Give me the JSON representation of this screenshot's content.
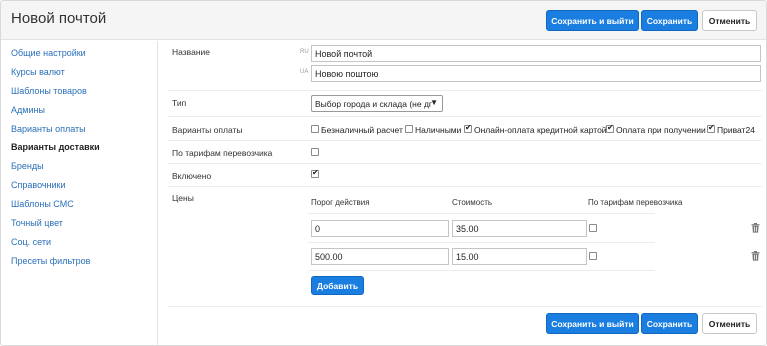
{
  "header": {
    "title": "Новой почтой",
    "save_exit_label": "Сохранить и выйти",
    "save_label": "Сохранить",
    "cancel_label": "Отменить"
  },
  "sidebar": {
    "items": [
      {
        "label": "Общие настройки"
      },
      {
        "label": "Курсы валют"
      },
      {
        "label": "Шаблоны товаров"
      },
      {
        "label": "Админы"
      },
      {
        "label": "Варианты оплаты"
      },
      {
        "label": "Варианты доставки",
        "active": true
      },
      {
        "label": "Бренды"
      },
      {
        "label": "Справочники"
      },
      {
        "label": "Шаблоны СМС"
      },
      {
        "label": "Точный цвет"
      },
      {
        "label": "Соц. сети"
      },
      {
        "label": "Пресеты фильтров"
      }
    ]
  },
  "form": {
    "name_label": "Название",
    "name_ru_tag": "RU",
    "name_ru_value": "Новой почтой",
    "name_ua_tag": "UA",
    "name_ua_value": "Новою поштою",
    "type_label": "Тип",
    "type_value": "Выбор города и склада (не дг",
    "payment_label": "Варианты оплаты",
    "payment_options": [
      {
        "label": "Безналичный расчет",
        "checked": false
      },
      {
        "label": "Наличными",
        "checked": false
      },
      {
        "label": "Онлайн-оплата кредитной картой",
        "checked": true
      },
      {
        "label": "Оплата при получении",
        "checked": true
      },
      {
        "label": "Приват24",
        "checked": true
      }
    ],
    "carrier_tariff_label": "По тарифам перевозчика",
    "carrier_tariff_checked": false,
    "enabled_label": "Включено",
    "enabled_checked": true,
    "prices_label": "Цены",
    "prices_columns": {
      "threshold": "Порог действия",
      "cost": "Стоимость",
      "carrier": "По тарифам перевозчика"
    },
    "prices_rows": [
      {
        "threshold": "0",
        "cost": "35.00",
        "carrier": false
      },
      {
        "threshold": "500.00",
        "cost": "15.00",
        "carrier": false
      }
    ],
    "add_label": "Добавить"
  },
  "footer": {
    "save_exit_label": "Сохранить и выйти",
    "save_label": "Сохранить",
    "cancel_label": "Отменить"
  },
  "colors": {
    "primary": "#1a7ee0",
    "link": "#2a6fb8",
    "header_bg": "#f5f5f5"
  }
}
